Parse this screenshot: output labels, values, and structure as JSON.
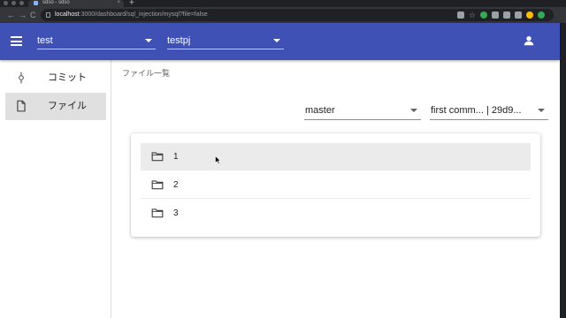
{
  "browser": {
    "tab_title": "sdso - sdso",
    "new_tab": "+",
    "tab_close": "×",
    "back": "←",
    "forward": "→",
    "reload": "C",
    "url_host": "localhost",
    "url_path": ":3000/dashboard/sql_injection/mysql?file=false",
    "bookmark_star": "☆"
  },
  "appbar": {
    "color": "#3f51b5",
    "project_select": {
      "value": "test"
    },
    "repo_select": {
      "value": "testpj"
    }
  },
  "sidebar": {
    "items": [
      {
        "label": "コミット",
        "icon": "commit-icon",
        "active": false
      },
      {
        "label": "ファイル",
        "icon": "file-icon",
        "active": true
      }
    ]
  },
  "main": {
    "breadcrumb": "ファイル一覧",
    "branch_select": {
      "value": "master"
    },
    "commit_select": {
      "value": "first comm... | 29d9..."
    },
    "files": [
      {
        "name": "1",
        "icon": "folder-icon",
        "hovered": true
      },
      {
        "name": "2",
        "icon": "folder-icon",
        "hovered": false
      },
      {
        "name": "3",
        "icon": "folder-icon",
        "hovered": false
      }
    ]
  }
}
